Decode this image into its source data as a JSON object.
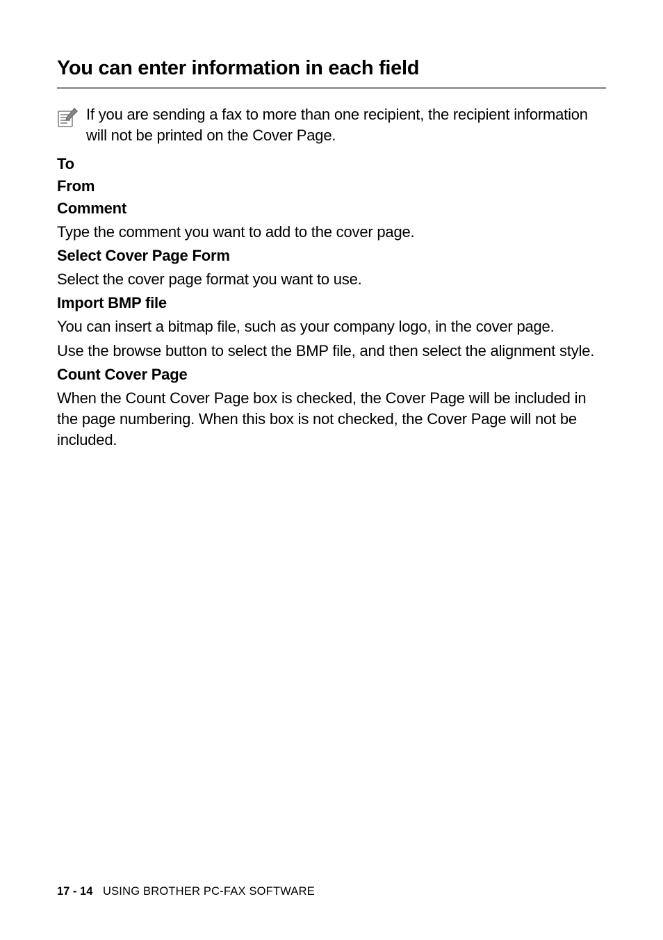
{
  "title": "You can enter information in each field",
  "note": "If you are sending a fax to more than one recipient, the recipient information will not be printed on the Cover Page.",
  "sections": {
    "to": "To",
    "from": "From",
    "comment": {
      "heading": "Comment",
      "body": "Type the comment you want to add to the cover page."
    },
    "select_cover": {
      "heading": "Select Cover Page Form",
      "body": "Select the cover page format you want to use."
    },
    "import_bmp": {
      "heading": "Import BMP file",
      "body1": "You can insert a bitmap file, such as your company logo, in the cover page.",
      "body2": "Use the browse button to select the BMP file, and then select the alignment style."
    },
    "count_cover": {
      "heading": "Count Cover Page",
      "body": "When the Count Cover Page box is checked, the Cover Page will be included in the page numbering. When this box is not checked, the Cover Page will not be included."
    }
  },
  "footer": {
    "page": "17 - 14",
    "section": "USING BROTHER PC-FAX SOFTWARE"
  }
}
